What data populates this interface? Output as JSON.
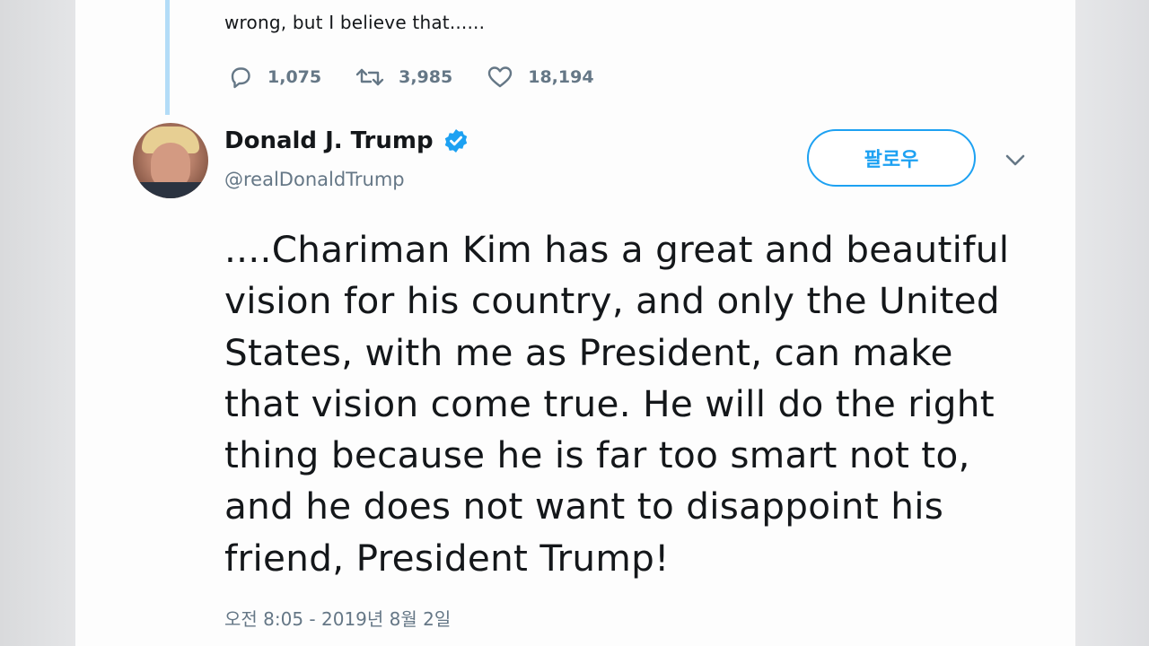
{
  "previous_tweet": {
    "cropped_line": "",
    "text": "wrong, but I believe that......",
    "replies": "1,075",
    "retweets": "3,985",
    "likes": "18,194"
  },
  "tweet": {
    "author_name": "Donald J. Trump",
    "handle": "@realDonaldTrump",
    "follow_label": "팔로우",
    "text": "....Chariman Kim has a great and beautiful vision for his country, and only the United States, with me as President, can make that vision come true. He will do the right thing because he is far too smart not to, and he does not want to disappoint his friend, President Trump!",
    "timestamp": "오전 8:05 - 2019년 8월 2일"
  },
  "icons": {
    "reply": "reply-icon",
    "retweet": "retweet-icon",
    "like": "heart-icon",
    "verified": "verified-badge-icon",
    "menu": "chevron-down-icon"
  },
  "colors": {
    "accent": "#1da1f2",
    "thread_line": "#b3dcf7",
    "secondary_text": "#657786",
    "primary_text": "#14171a"
  }
}
